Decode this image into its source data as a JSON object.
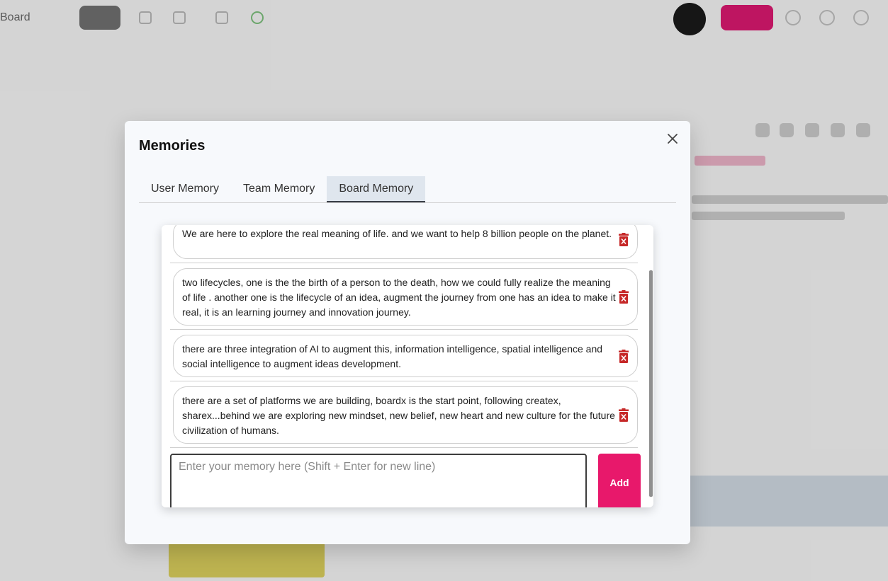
{
  "background": {
    "top_left_text": "Board"
  },
  "dialog": {
    "title": "Memories",
    "close_icon": "close-icon",
    "tabs": [
      {
        "label": "User Memory",
        "active": false
      },
      {
        "label": "Team Memory",
        "active": false
      },
      {
        "label": "Board Memory",
        "active": true
      }
    ],
    "memories": [
      {
        "text": "We are here to explore the real meaning of life. and we want to help 8 billion people on the planet."
      },
      {
        "text": "two lifecycles, one is the the birth of a person to the death, how we could fully realize the meaning of life . another one is the lifecycle of an idea, augment the journey from one has an idea to make it real, it is an learning journey and innovation journey."
      },
      {
        "text": "there are three integration of AI to augment this, information intelligence, spatial intelligence and social intelligence to augment ideas development."
      },
      {
        "text": "there are a set of platforms we are building, boardx is the start point, following createx, sharex...behind we are exploring new mindset, new belief, new heart and new culture for the future civilization of humans."
      }
    ],
    "delete_icon": "trash-icon",
    "input": {
      "value": "",
      "placeholder": "Enter your memory here (Shift + Enter for new line)"
    },
    "add_label": "Add"
  },
  "colors": {
    "accent": "#e8186b",
    "delete": "#c62828"
  }
}
